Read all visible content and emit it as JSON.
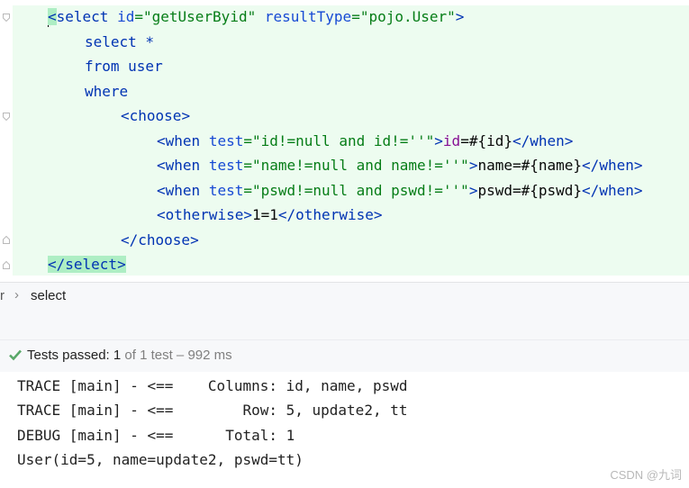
{
  "editor": {
    "line1": {
      "open": "<",
      "tag": "select",
      "attr1": "id",
      "eq1": "=",
      "val1": "\"getUserByid\"",
      "attr2": "resultType",
      "eq2": "=",
      "val2": "\"pojo.User\"",
      "close": ">"
    },
    "line2": "select *",
    "line3": "from user",
    "line4": "where",
    "line5": {
      "open": "<",
      "tag": "choose",
      "close": ">"
    },
    "line6": {
      "open": "<",
      "tag": "when",
      "attr": "test",
      "eq": "=",
      "val": "\"id!=null and id!=''\"",
      "close": ">",
      "body_a": "id",
      "body_b": "=#{id}",
      "end_open": "</",
      "end_tag": "when",
      "end_close": ">"
    },
    "line7": {
      "open": "<",
      "tag": "when",
      "attr": "test",
      "eq": "=",
      "val": "\"name!=null and name!=''\"",
      "close": ">",
      "body": "name=#{name}",
      "end_open": "</",
      "end_tag": "when",
      "end_close": ">"
    },
    "line8": {
      "open": "<",
      "tag": "when",
      "attr": "test",
      "eq": "=",
      "val": "\"pswd!=null and pswd!=''\"",
      "close": ">",
      "body": "pswd=#{pswd}",
      "end_open": "</",
      "end_tag": "when",
      "end_close": ">"
    },
    "line9": {
      "open": "<",
      "tag": "otherwise",
      "close": ">",
      "body": "1=1",
      "end_open": "</",
      "end_tag": "otherwise",
      "end_close": ">"
    },
    "line10": {
      "open": "</",
      "tag": "choose",
      "close": ">"
    },
    "line11": {
      "open": "</",
      "tag": "select",
      "close": ">"
    }
  },
  "breadcrumb": {
    "left": "r",
    "separator": "›",
    "current": "select"
  },
  "status": {
    "label": "Tests passed: ",
    "count": "1",
    "rest": " of 1 test – 992 ms"
  },
  "console": [
    "TRACE [main] - <==    Columns: id, name, pswd",
    "TRACE [main] - <==        Row: 5, update2, tt",
    "DEBUG [main] - <==      Total: 1",
    "User(id=5, name=update2, pswd=tt)"
  ],
  "watermark": "CSDN @九词",
  "colors": {
    "highlight": "#edfcf0",
    "tag": "#0033b3",
    "string": "#067d17",
    "check": "#59a869"
  }
}
